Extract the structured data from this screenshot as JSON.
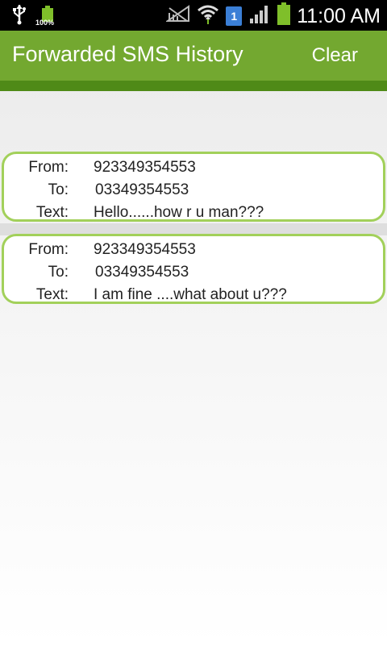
{
  "status_bar": {
    "battery_percent": "100%",
    "sim_slot": "1",
    "time": "11:00 AM",
    "icons": [
      "usb-icon",
      "battery-charging-icon",
      "no-signal-icon",
      "wifi-icon",
      "sim-icon",
      "cell-signal-icon",
      "battery-icon"
    ]
  },
  "app_bar": {
    "title": "Forwarded SMS History",
    "clear_label": "Clear",
    "accent_color": "#73a830"
  },
  "messages": [
    {
      "from_label": "From:",
      "from": "923349354553",
      "to_label": "To:",
      "to": "03349354553",
      "text_label": "Text:",
      "text": "Hello......how r u man???"
    },
    {
      "from_label": "From:",
      "from": "923349354553",
      "to_label": "To:",
      "to": "03349354553",
      "text_label": "Text:",
      "text": "I am fine ....what about u???"
    }
  ]
}
